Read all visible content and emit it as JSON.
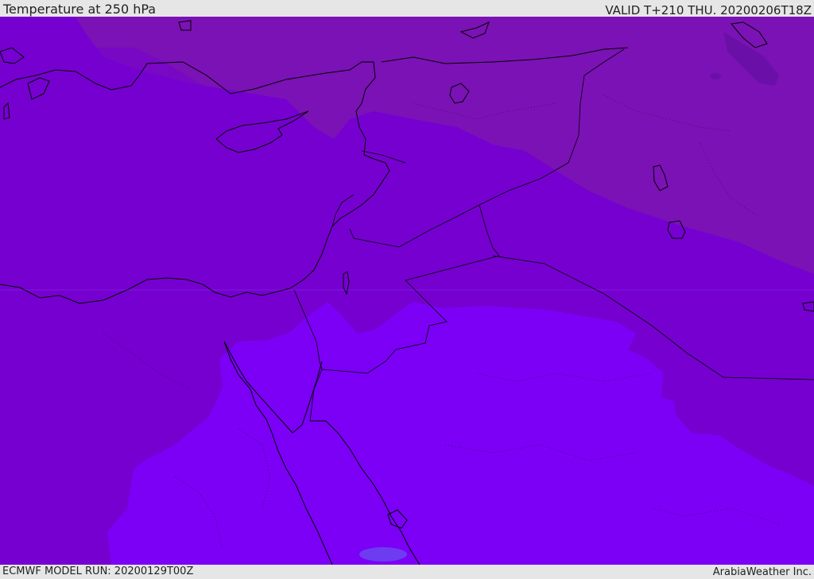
{
  "header": {
    "title": "Temperature at 250 hPa",
    "valid_time": "VALID T+210 THU. 20200206T18Z"
  },
  "footer": {
    "model_run": "ECMWF MODEL RUN: 20200129T00Z",
    "credit": "ArabiaWeather Inc."
  },
  "map": {
    "field": "temperature-250hpa",
    "colors": {
      "deep_violet": "#6a10a8",
      "dark_violet": "#7b12b5",
      "medium_violet": "#7600d0",
      "bright_violet": "#7b00f5",
      "faint_blue_spot": "#6a4bf0",
      "coastline": "#000000"
    }
  }
}
